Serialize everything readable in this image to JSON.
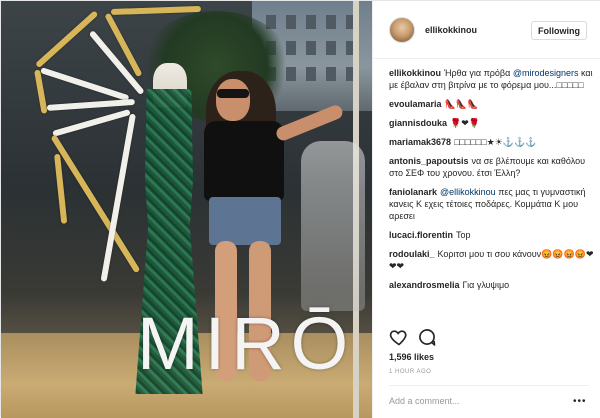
{
  "post": {
    "username": "ellikokkinou",
    "follow_label": "Following",
    "photo_logo_text": "MIRŌ"
  },
  "comments": [
    {
      "user": "ellikokkinou",
      "text": "Ήρθα για πρόβα ",
      "mention": "@mirodesigners",
      "text_after": " και με έβαλαν στη βιτρίνα με το φόρεμα μου...□□□□□"
    },
    {
      "user": "evoulamaria",
      "text": "👠👠👠",
      "mention": "",
      "text_after": ""
    },
    {
      "user": "giannisdouka",
      "text": "🌹❤🌹",
      "mention": "",
      "text_after": ""
    },
    {
      "user": "mariamak3678",
      "text": "□□□□□□★☀⚓⚓⚓",
      "mention": "",
      "text_after": ""
    },
    {
      "user": "antonis_papoutsis",
      "text": "να σε βλέπουμε και καθόλου στο ΣΕΦ του χρονου. έτσι Έλλη?",
      "mention": "",
      "text_after": ""
    },
    {
      "user": "faniolanark",
      "text": "",
      "mention": "@ellikokkinou",
      "text_after": " πες μας τι γυμναστική κανεις Κ εχεις τέτοιες ποδάρες. Κομμάτια Κ μου αρεσει"
    },
    {
      "user": "lucaci.florentin",
      "text": "Top",
      "mention": "",
      "text_after": ""
    },
    {
      "user": "rodoulaki_",
      "text": "Κοριτσι μου τι σου κάνουν😡😡😡😡❤❤❤",
      "mention": "",
      "text_after": ""
    },
    {
      "user": "alexandrosmelia",
      "text": "Για γλυψιμο",
      "mention": "",
      "text_after": ""
    }
  ],
  "footer": {
    "likes": "1,596 likes",
    "time": "1 HOUR AGO",
    "add_comment_placeholder": "Add a comment...",
    "more": "•••"
  },
  "icons": {
    "heart": "heart-icon",
    "comment": "comment-icon",
    "more": "more-options-icon"
  },
  "colors": {
    "mention": "#003569",
    "text": "#262626",
    "muted": "#999999",
    "border": "#efefef"
  }
}
